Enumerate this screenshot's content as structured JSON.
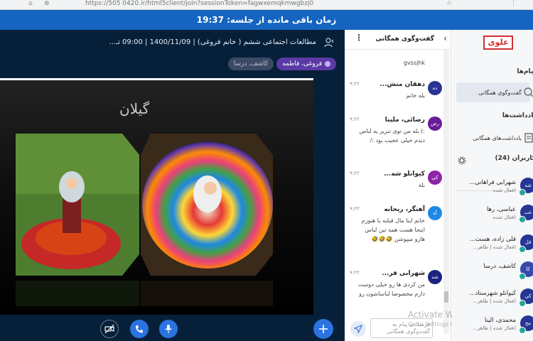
{
  "browser": {
    "url": "https://505 0420.ir/html5client/join?sessionToken=fagwxemqkmwgbzj0",
    "ico_left1": "⌂",
    "ico_left2": "⊕",
    "ico_right1": "☆",
    "ico_right2": "⋮"
  },
  "timer": {
    "text": "زمان باقی مانده از جلسه: 19:37"
  },
  "meeting": {
    "title": "مطالعات اجتماعی ششم ( خانم فروغی) | 1400/11/09 | 09:00 تـ...",
    "chips": [
      {
        "label": "فروغی، فاطمه"
      },
      {
        "label": "کاشف، درسا"
      }
    ],
    "slide_title": "گیلان"
  },
  "chat": {
    "title": "گفت‌وگوی همگانی",
    "back": "‹",
    "menu": "⋮",
    "messages": [
      {
        "name": "",
        "time": "",
        "text": "gvssjhk",
        "avatar": ""
      },
      {
        "name": "دهقان منش...",
        "time": "۹:۲۲",
        "text": "بله خانم",
        "avatar": "ده"
      },
      {
        "name": "رضائی، ملینا",
        "time": "۹:۲۲",
        "text": ":) بله من توی تبریز یه لباس دیدم خیلی عجیب بود :/",
        "avatar": "رض"
      },
      {
        "name": "کیوانلو شه...",
        "time": "۹:۲۲",
        "text": "بله",
        "avatar": "کی"
      },
      {
        "name": "آهنگر، ریحانه",
        "time": "۹:۲۳",
        "text": "خانم اینا مال قبلنه یا هنوزم اینجا هست همه تین لباس هارو میپوشن 🤣🤣🤣",
        "avatar": "آه"
      },
      {
        "name": "شهرابی فر...",
        "time": "۹:۲۴",
        "text": "من کردی ها رو خیلی دوست دارم مخصوصا لباساشون رو",
        "avatar": "شه"
      }
    ],
    "input_placeholder": "فرستادن پیام به گفت‌وگوی همگانی"
  },
  "watermark": {
    "line1": "Activate Windows",
    "line2": "Go to Settings to activate Windows."
  },
  "sidebar": {
    "logo": "علوی",
    "messages_heading": "پیام‌ها",
    "public_chat": "گفت‌وگوی همگانی",
    "notes_heading": "یادداشت‌ها",
    "shared_notes": "یادداشت‌های همگانی",
    "users_heading": "کاربران (24)",
    "users": [
      {
        "name": "شهرابی فراهانی...",
        "sub": "(فعال شده",
        "av": "شه"
      },
      {
        "name": "عباسی، رها",
        "sub": "(فعال شده",
        "av": "عب"
      },
      {
        "name": "قلی زاده، هست...",
        "sub": "(فعال شده | ظاهر...",
        "av": "قل"
      },
      {
        "name": "کاشف، درسا",
        "sub": "",
        "av": "کا"
      },
      {
        "name": "کیوانلو شهرستاد...",
        "sub": "(فعال شده | ظاهر...",
        "av": "کی"
      },
      {
        "name": "محمدی، الینا",
        "sub": "(فعال شده | ظاهر...",
        "av": "مح"
      }
    ]
  }
}
